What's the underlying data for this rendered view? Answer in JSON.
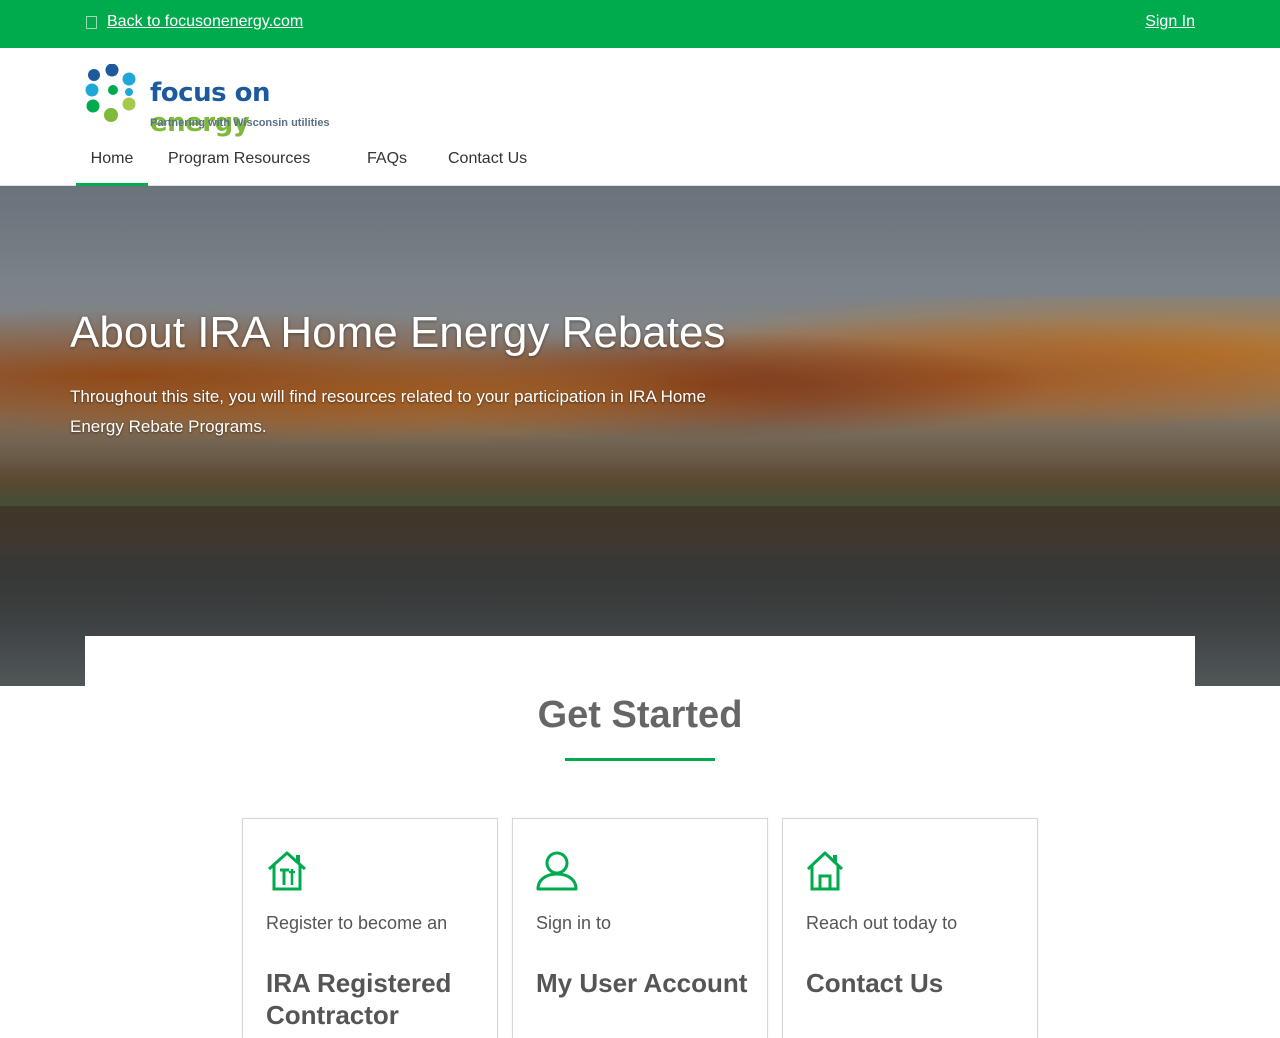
{
  "topbar": {
    "back_link": "Back to focusonenergy.com",
    "sign_in": "Sign In"
  },
  "logo": {
    "brand_main": "focus on ",
    "brand_accent": "energy",
    "tagline": "Partnering with Wisconsin utilities",
    "colors": [
      "#1c5a9c",
      "#1fa7d8",
      "#00ab4e",
      "#7dba3a",
      "#a6c94a"
    ]
  },
  "nav": {
    "items": [
      {
        "label": "Home",
        "active": true
      },
      {
        "label": "Program Resources",
        "active": false
      },
      {
        "label": "FAQs",
        "active": false
      },
      {
        "label": "Contact Us",
        "active": false
      }
    ]
  },
  "hero": {
    "title": "About IRA Home Energy Rebates",
    "text": "Throughout this site, you will find resources related to your participation in IRA Home Energy Rebate Programs."
  },
  "get_started": {
    "title": "Get Started",
    "cards": [
      {
        "icon": "house-tools-icon",
        "lead": "Register to become an",
        "title": "IRA Registered Contractor"
      },
      {
        "icon": "user-icon",
        "lead": "Sign in to",
        "title": "My User Account"
      },
      {
        "icon": "house-icon",
        "lead": "Reach out today to",
        "title": "Contact Us"
      }
    ]
  },
  "colors": {
    "brand_green": "#00ab4e",
    "text_dark": "#555555",
    "heading_gray": "#666666"
  }
}
